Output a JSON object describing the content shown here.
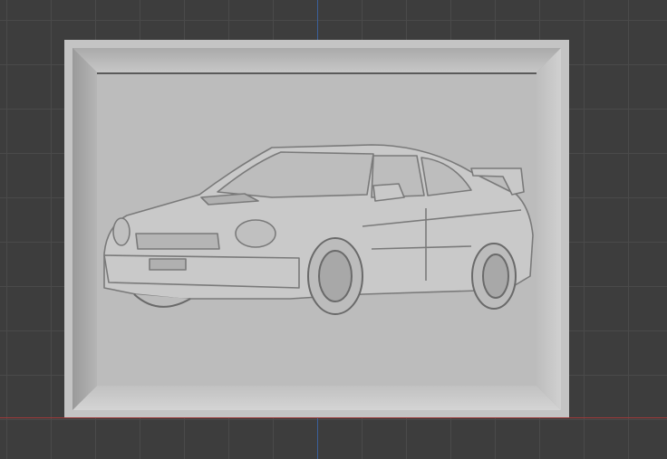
{
  "viewport": {
    "object": "relief-plaque",
    "subject": "car-relief",
    "colors": {
      "background": "#3d3d3d",
      "grid": "#4a4a4a",
      "x_axis": "#a03a3a",
      "y_axis": "#3a5f9a",
      "model": "#bcbcbc"
    }
  }
}
